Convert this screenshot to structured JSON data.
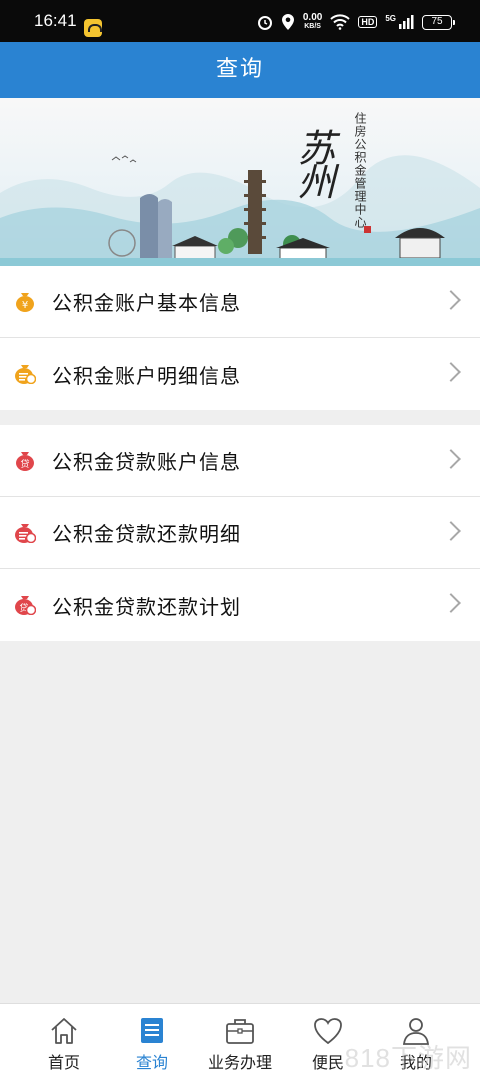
{
  "status_bar": {
    "time": "16:41",
    "net_speed": "0.00",
    "net_unit": "KB/S",
    "hd": "HD",
    "network": "5G",
    "battery": "75"
  },
  "title": "查询",
  "banner": {
    "city": "苏州",
    "org_text": "住房公积金管理中心"
  },
  "menu_groups": [
    {
      "items": [
        {
          "label": "公积金账户基本信息",
          "icon": "coin-yuan-icon"
        },
        {
          "label": "公积金账户明细信息",
          "icon": "coin-list-icon"
        }
      ]
    },
    {
      "items": [
        {
          "label": "公积金贷款账户信息",
          "icon": "loan-bag-icon"
        },
        {
          "label": "公积金贷款还款明细",
          "icon": "repay-detail-icon"
        },
        {
          "label": "公积金贷款还款计划",
          "icon": "repay-plan-icon"
        }
      ]
    }
  ],
  "bottom_nav": [
    {
      "label": "首页",
      "icon": "home-icon",
      "active": false
    },
    {
      "label": "查询",
      "icon": "query-list-icon",
      "active": true
    },
    {
      "label": "业务办理",
      "icon": "briefcase-icon",
      "active": false
    },
    {
      "label": "便民",
      "icon": "heart-icon",
      "active": false
    },
    {
      "label": "我的",
      "icon": "user-icon",
      "active": false
    }
  ],
  "watermark": "818下游网",
  "colors": {
    "primary": "#2a83d2",
    "coin_gold": "#f0a31c",
    "loan_red": "#e0464b"
  }
}
